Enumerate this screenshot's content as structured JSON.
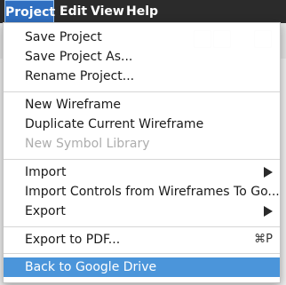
{
  "menubar": {
    "items": [
      "Project",
      "Edit",
      "View",
      "Help"
    ]
  },
  "menu": {
    "items": [
      {
        "label": "Save Project",
        "enabled": true
      },
      {
        "label": "Save Project As...",
        "enabled": true
      },
      {
        "label": "Rename Project...",
        "enabled": true
      },
      {
        "label": "New Wireframe",
        "enabled": true
      },
      {
        "label": "Duplicate Current Wireframe",
        "enabled": true
      },
      {
        "label": "New Symbol Library",
        "enabled": false
      },
      {
        "label": "Import",
        "enabled": true,
        "submenu": true
      },
      {
        "label": "Import Controls from Wireframes To Go...",
        "enabled": true
      },
      {
        "label": "Export",
        "enabled": true,
        "submenu": true
      },
      {
        "label": "Export to PDF...",
        "enabled": true,
        "shortcut": "⌘P"
      },
      {
        "label": "Back to Google Drive",
        "enabled": true,
        "highlighted": true
      }
    ]
  },
  "colors": {
    "menubar_bg": "#2b2b2b",
    "selected_menu": "#2f6fc1",
    "highlight": "#4b95da",
    "disabled_text": "#adadad"
  }
}
